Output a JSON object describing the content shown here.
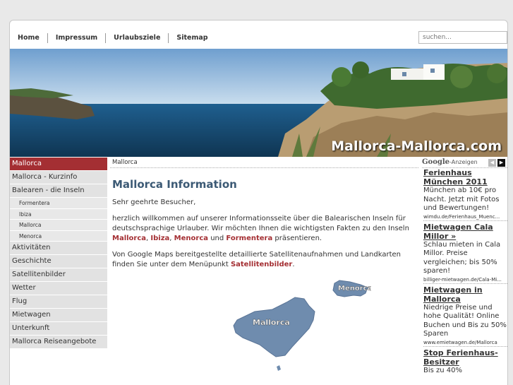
{
  "nav": [
    "Home",
    "Impressum",
    "Urlaubsziele",
    "Sitemap"
  ],
  "search": {
    "placeholder": "suchen..."
  },
  "hero": {
    "title": "Mallorca-Mallorca.com"
  },
  "sidebar": {
    "items": [
      {
        "label": "Mallorca",
        "active": true
      },
      {
        "label": "Mallorca - Kurzinfo"
      },
      {
        "label": "Balearen - die Inseln"
      },
      {
        "label": "Formentera",
        "sub": true
      },
      {
        "label": "Ibiza",
        "sub": true
      },
      {
        "label": "Mallorca",
        "sub": true
      },
      {
        "label": "Menorca",
        "sub": true
      },
      {
        "label": "Aktivitäten"
      },
      {
        "label": "Geschichte"
      },
      {
        "label": "Satellitenbilder"
      },
      {
        "label": "Wetter"
      },
      {
        "label": "Flug"
      },
      {
        "label": "Mietwagen"
      },
      {
        "label": "Unterkunft"
      },
      {
        "label": "Mallorca Reiseangebote"
      }
    ]
  },
  "content": {
    "breadcrumb": "Mallorca",
    "title": "Mallorca Information",
    "greeting": "Sehr geehrte Besucher,",
    "intro_text": "herzlich willkommen auf unserer Informationsseite über die Balearischen Inseln für deutschsprachige Urlauber. Wir möchten Ihnen die wichtigsten Fakten zu den Inseln",
    "link_mallorca": "Mallorca",
    "link_ibiza": "Ibiza",
    "link_menorca": "Menorca",
    "link_formentera": "Formentera",
    "sep_comma": ",",
    "sep_und": "und",
    "intro_end": "präsentieren.",
    "maps_text": "Von Google Maps bereitgestellte detaillierte Satellitenaufnahmen und Landkarten finden Sie unter dem Menüpunkt",
    "link_satellitenbilder": "Satellitenbilder",
    "maps_end": ".",
    "map_label_mallorca": "Mallorca",
    "map_label_menorca": "Menorca"
  },
  "ads": {
    "google_brand": "Google",
    "label": "-Anzeigen",
    "items": [
      {
        "title": "Ferienhaus München 2011",
        "text": "München ab 10€ pro Nacht. Jetzt mit Fotos und Bewertungen!",
        "url": "wimdu.de/Ferienhaus_Muenc..."
      },
      {
        "title": "Mietwagen Cala Millor »",
        "text": "Schlau mieten in Cala Millor. Preise vergleichen; bis 50% sparen!",
        "url": "billiger-mietwagen.de/Cala-Mi..."
      },
      {
        "title": "Mietwagen in Mallorca",
        "text": "Niedrige Preise und hohe Qualität! Online Buchen und Bis zu 50% Sparen",
        "url": "www.emietwagen.de/Mallorca"
      },
      {
        "title": "Stop Ferienhaus-Besitzer",
        "text": "Bis zu 40%",
        "url": ""
      }
    ]
  },
  "colors": {
    "accent": "#a42f33",
    "heading": "#3c5a75",
    "map_fill": "#6f8cae"
  }
}
